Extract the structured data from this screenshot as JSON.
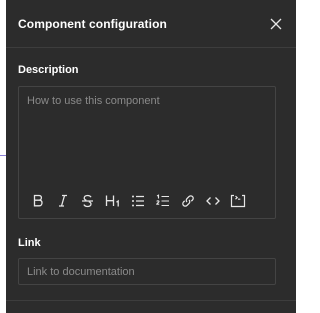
{
  "dialog": {
    "title": "Component configuration",
    "close_icon": "close-icon"
  },
  "description": {
    "label": "Description",
    "placeholder": "How to use this component",
    "toolbar": [
      {
        "name": "bold",
        "icon": "bold-icon"
      },
      {
        "name": "italic",
        "icon": "italic-icon"
      },
      {
        "name": "strikethrough",
        "icon": "strikethrough-icon"
      },
      {
        "name": "heading",
        "icon": "heading-1-icon"
      },
      {
        "name": "bulleted-list",
        "icon": "bulleted-list-icon"
      },
      {
        "name": "numbered-list",
        "icon": "numbered-list-icon"
      },
      {
        "name": "link",
        "icon": "link-icon"
      },
      {
        "name": "code",
        "icon": "code-icon"
      },
      {
        "name": "code-block",
        "icon": "code-block-icon"
      }
    ]
  },
  "link": {
    "label": "Link",
    "placeholder": "Link to documentation"
  },
  "colors": {
    "panel_bg": "#2c2c2c",
    "border": "#444444",
    "text": "#ffffff",
    "placeholder": "#8a8a8a"
  }
}
